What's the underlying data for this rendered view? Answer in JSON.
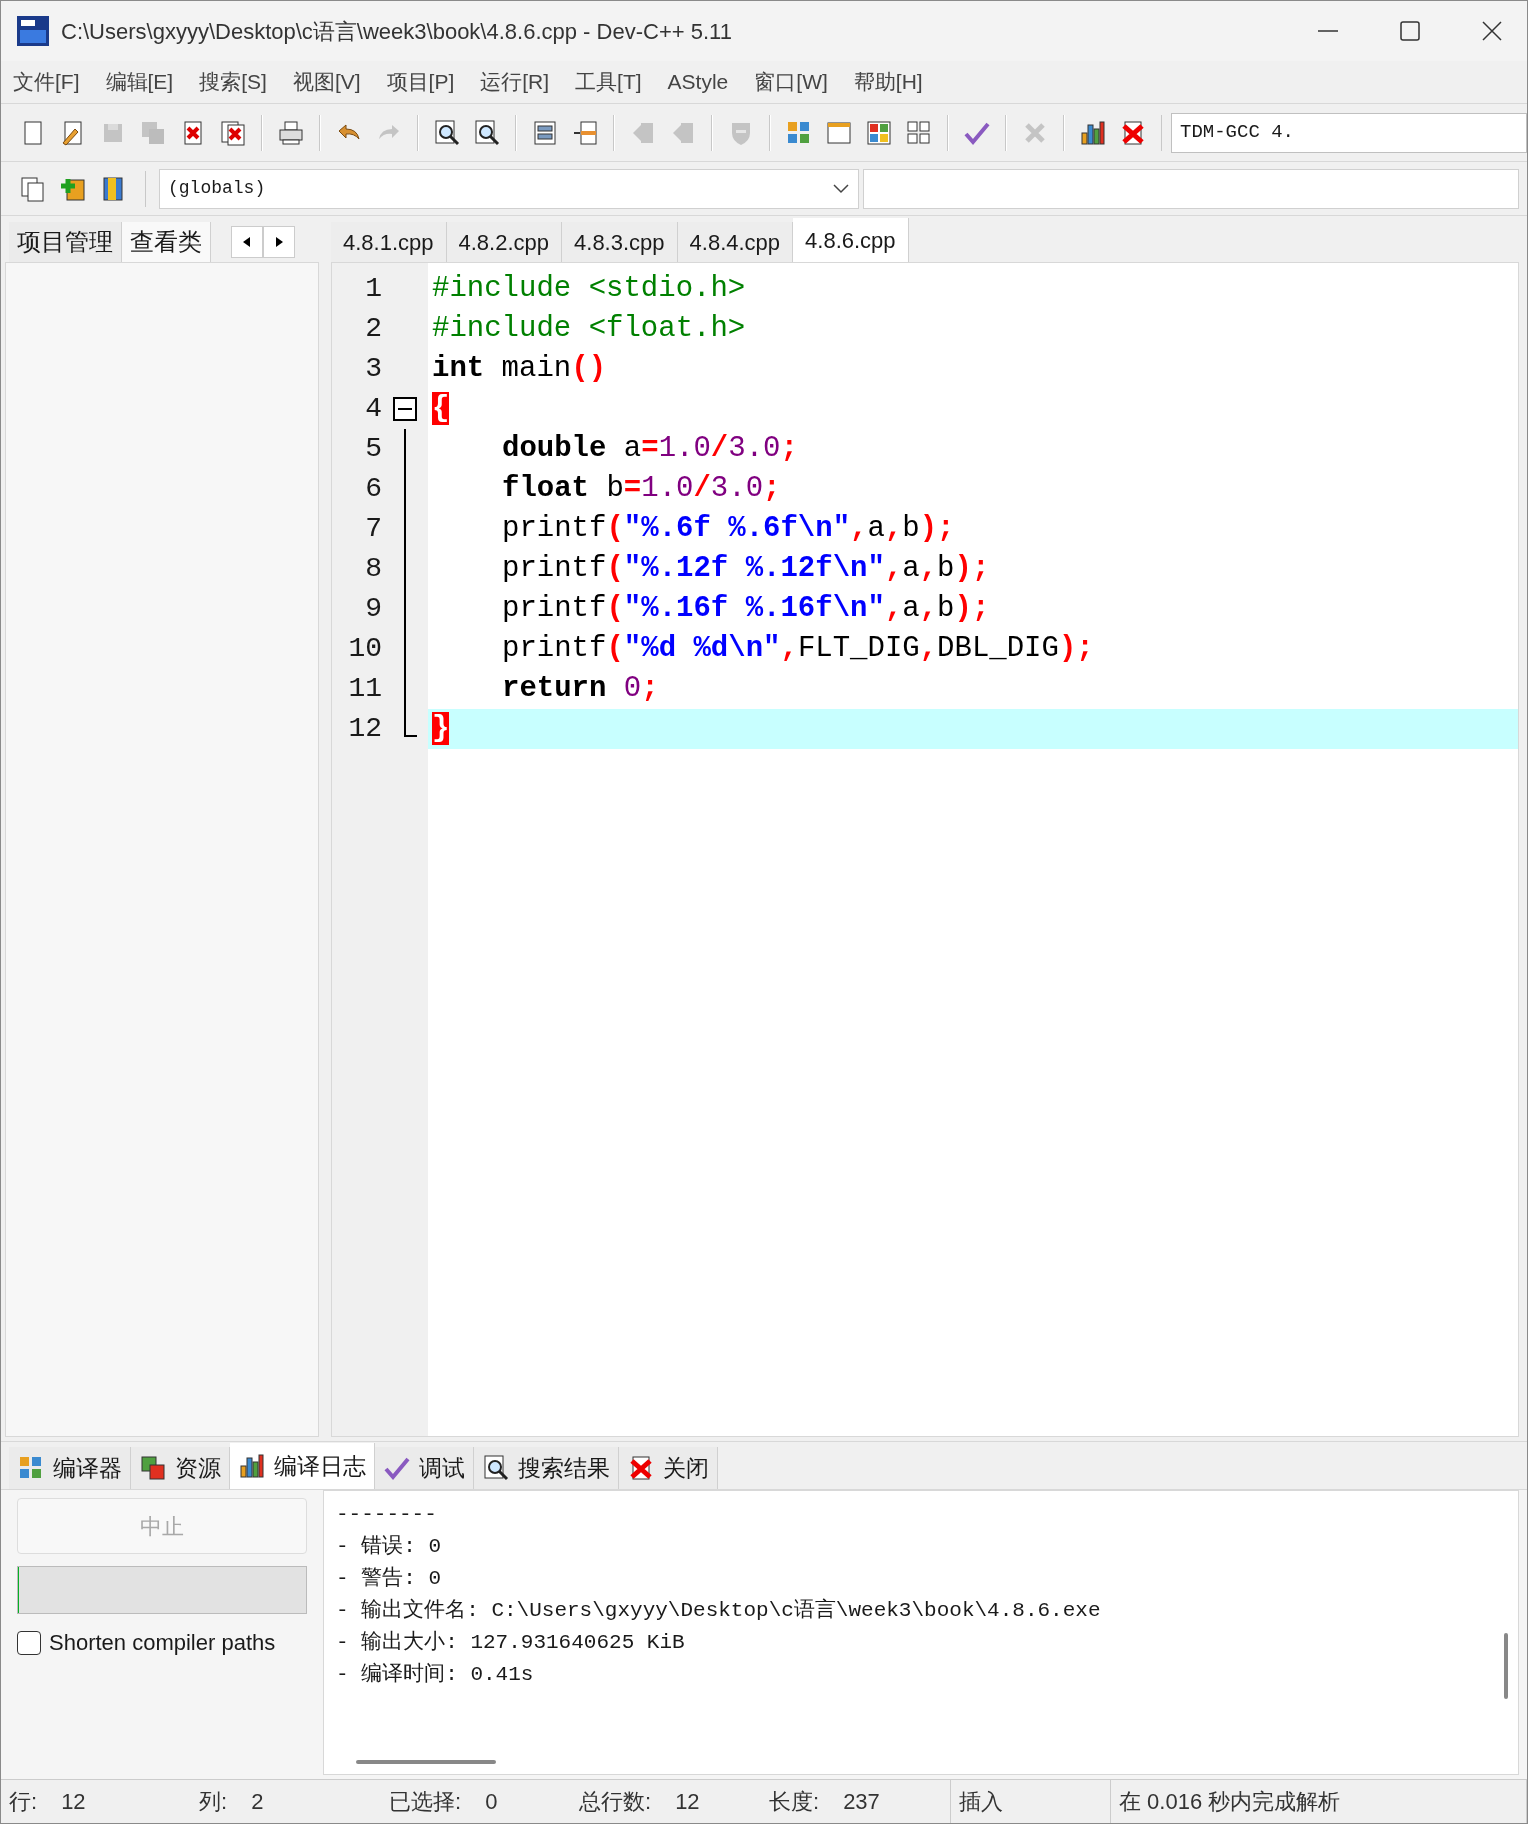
{
  "window": {
    "title": "C:\\Users\\gxyyy\\Desktop\\c语言\\week3\\book\\4.8.6.cpp - Dev-C++ 5.11"
  },
  "menu": [
    "文件[F]",
    "编辑[E]",
    "搜索[S]",
    "视图[V]",
    "项目[P]",
    "运行[R]",
    "工具[T]",
    "AStyle",
    "窗口[W]",
    "帮助[H]"
  ],
  "toolbar": [
    {
      "kind": "page",
      "disabled": false
    },
    {
      "kind": "page-edit",
      "disabled": false
    },
    {
      "kind": "save",
      "disabled": true
    },
    {
      "kind": "save-all",
      "disabled": true
    },
    {
      "kind": "close-file",
      "disabled": false
    },
    {
      "kind": "close-all",
      "disabled": false
    },
    {
      "kind": "separator"
    },
    {
      "kind": "print",
      "disabled": false
    },
    {
      "kind": "separator"
    },
    {
      "kind": "undo",
      "disabled": false
    },
    {
      "kind": "redo",
      "disabled": true
    },
    {
      "kind": "separator"
    },
    {
      "kind": "find",
      "disabled": false
    },
    {
      "kind": "find",
      "disabled": false
    },
    {
      "kind": "separator"
    },
    {
      "kind": "list",
      "disabled": false
    },
    {
      "kind": "columns",
      "disabled": false
    },
    {
      "kind": "separator"
    },
    {
      "kind": "back",
      "disabled": true
    },
    {
      "kind": "back",
      "disabled": true
    },
    {
      "kind": "separator"
    },
    {
      "kind": "shield",
      "disabled": true
    },
    {
      "kind": "separator"
    },
    {
      "kind": "grid",
      "disabled": false
    },
    {
      "kind": "window",
      "disabled": false
    },
    {
      "kind": "color-grid",
      "disabled": false
    },
    {
      "kind": "grid-outline",
      "disabled": false
    },
    {
      "kind": "separator"
    },
    {
      "kind": "check",
      "disabled": false
    },
    {
      "kind": "separator"
    },
    {
      "kind": "cross",
      "disabled": true
    },
    {
      "kind": "separator"
    },
    {
      "kind": "bar-chart",
      "disabled": false
    },
    {
      "kind": "delete",
      "disabled": false
    }
  ],
  "compiler_select": {
    "value": "TDM-GCC 4."
  },
  "toolbar2": [
    {
      "kind": "class-page",
      "disabled": false
    },
    {
      "kind": "add",
      "disabled": false
    },
    {
      "kind": "bookmark",
      "disabled": false
    }
  ],
  "scope_select": {
    "value": "(globals)"
  },
  "left_tabs": [
    {
      "label": "项目管理",
      "selected": false
    },
    {
      "label": "查看类",
      "selected": true
    }
  ],
  "file_tabs": [
    {
      "label": "4.8.1.cpp",
      "selected": false
    },
    {
      "label": "4.8.2.cpp",
      "selected": false
    },
    {
      "label": "4.8.3.cpp",
      "selected": false
    },
    {
      "label": "4.8.4.cpp",
      "selected": false
    },
    {
      "label": "4.8.6.cpp",
      "selected": true
    }
  ],
  "editor": {
    "lines": [
      {
        "number": "1",
        "kind": "plain",
        "indented": false,
        "current": false,
        "tokens": [
          {
            "kind": "preprocessor",
            "text": "#include <stdio.h>"
          }
        ]
      },
      {
        "number": "2",
        "kind": "plain",
        "indented": false,
        "current": false,
        "tokens": [
          {
            "kind": "preprocessor",
            "text": "#include <float.h>"
          }
        ]
      },
      {
        "number": "3",
        "kind": "plain",
        "indented": false,
        "current": false,
        "tokens": [
          {
            "kind": "keyword",
            "text": "int"
          },
          {
            "kind": "ident",
            "text": " main"
          },
          {
            "kind": "symbol",
            "text": "()"
          }
        ]
      },
      {
        "number": "4",
        "kind": "fold_start",
        "indented": false,
        "current": false,
        "tokens": [
          {
            "kind": "brace",
            "text": "{"
          }
        ]
      },
      {
        "number": "5",
        "kind": "fold_body",
        "indented": true,
        "current": false,
        "tokens": [
          {
            "kind": "keyword",
            "text": "double"
          },
          {
            "kind": "ident",
            "text": " a"
          },
          {
            "kind": "symbol",
            "text": "="
          },
          {
            "kind": "number",
            "text": "1.0"
          },
          {
            "kind": "symbol",
            "text": "/"
          },
          {
            "kind": "number",
            "text": "3.0"
          },
          {
            "kind": "symbol",
            "text": ";"
          }
        ]
      },
      {
        "number": "6",
        "kind": "fold_body",
        "indented": true,
        "current": false,
        "tokens": [
          {
            "kind": "keyword",
            "text": "float"
          },
          {
            "kind": "ident",
            "text": " b"
          },
          {
            "kind": "symbol",
            "text": "="
          },
          {
            "kind": "number",
            "text": "1.0"
          },
          {
            "kind": "symbol",
            "text": "/"
          },
          {
            "kind": "number",
            "text": "3.0"
          },
          {
            "kind": "symbol",
            "text": ";"
          }
        ]
      },
      {
        "number": "7",
        "kind": "fold_body",
        "indented": true,
        "current": false,
        "tokens": [
          {
            "kind": "ident",
            "text": "printf"
          },
          {
            "kind": "symbol",
            "text": "("
          },
          {
            "kind": "string",
            "text": "\"%.6f %.6f\\n\""
          },
          {
            "kind": "symbol",
            "text": ","
          },
          {
            "kind": "ident",
            "text": "a"
          },
          {
            "kind": "symbol",
            "text": ","
          },
          {
            "kind": "ident",
            "text": "b"
          },
          {
            "kind": "symbol",
            "text": ");"
          }
        ]
      },
      {
        "number": "8",
        "kind": "fold_body",
        "indented": true,
        "current": false,
        "tokens": [
          {
            "kind": "ident",
            "text": "printf"
          },
          {
            "kind": "symbol",
            "text": "("
          },
          {
            "kind": "string",
            "text": "\"%.12f %.12f\\n\""
          },
          {
            "kind": "symbol",
            "text": ","
          },
          {
            "kind": "ident",
            "text": "a"
          },
          {
            "kind": "symbol",
            "text": ","
          },
          {
            "kind": "ident",
            "text": "b"
          },
          {
            "kind": "symbol",
            "text": ");"
          }
        ]
      },
      {
        "number": "9",
        "kind": "fold_body",
        "indented": true,
        "current": false,
        "tokens": [
          {
            "kind": "ident",
            "text": "printf"
          },
          {
            "kind": "symbol",
            "text": "("
          },
          {
            "kind": "string",
            "text": "\"%.16f %.16f\\n\""
          },
          {
            "kind": "symbol",
            "text": ","
          },
          {
            "kind": "ident",
            "text": "a"
          },
          {
            "kind": "symbol",
            "text": ","
          },
          {
            "kind": "ident",
            "text": "b"
          },
          {
            "kind": "symbol",
            "text": ");"
          }
        ]
      },
      {
        "number": "10",
        "kind": "fold_body",
        "indented": true,
        "current": false,
        "tokens": [
          {
            "kind": "ident",
            "text": "printf"
          },
          {
            "kind": "symbol",
            "text": "("
          },
          {
            "kind": "string",
            "text": "\"%d %d\\n\""
          },
          {
            "kind": "symbol",
            "text": ","
          },
          {
            "kind": "ident",
            "text": "FLT_DIG"
          },
          {
            "kind": "symbol",
            "text": ","
          },
          {
            "kind": "ident",
            "text": "DBL_DIG"
          },
          {
            "kind": "symbol",
            "text": ");"
          }
        ]
      },
      {
        "number": "11",
        "kind": "fold_body",
        "indented": true,
        "current": false,
        "tokens": [
          {
            "kind": "keyword",
            "text": "return"
          },
          {
            "kind": "number",
            "text": " 0"
          },
          {
            "kind": "symbol",
            "text": ";"
          }
        ]
      },
      {
        "number": "12",
        "kind": "fold_end",
        "indented": false,
        "current": true,
        "tokens": [
          {
            "kind": "brace",
            "text": "}"
          }
        ]
      }
    ]
  },
  "bottom_tabs": [
    {
      "label": "编译器",
      "kind": "grid",
      "selected": false
    },
    {
      "label": "资源",
      "kind": "windows",
      "selected": false
    },
    {
      "label": "编译日志",
      "kind": "bar-chart",
      "selected": true
    },
    {
      "label": "调试",
      "kind": "check",
      "selected": false
    },
    {
      "label": "搜索结果",
      "kind": "find",
      "selected": false
    },
    {
      "label": "关闭",
      "kind": "delete",
      "selected": false
    }
  ],
  "abort_button": {
    "label": "中止",
    "disabled": true
  },
  "progress": {
    "level": 0
  },
  "shorten_paths": {
    "label": "Shorten compiler paths",
    "checked": false
  },
  "log": [
    "--------",
    "- 错误: 0",
    "- 警告: 0",
    "- 输出文件名: C:\\Users\\gxyyy\\Desktop\\c语言\\week3\\book\\4.8.6.exe",
    "- 输出大小: 127.931640625 KiB",
    "- 编译时间: 0.41s"
  ],
  "status_bar": [
    {
      "label": "行:",
      "value": "12"
    },
    {
      "label": "列:",
      "value": "2"
    },
    {
      "label": "已选择:",
      "value": "0"
    },
    {
      "label": "总行数:",
      "value": "12"
    },
    {
      "label": "长度:",
      "value": "237"
    },
    {
      "label": "插入"
    },
    {
      "label": "在 0.016 秒内完成解析"
    }
  ]
}
